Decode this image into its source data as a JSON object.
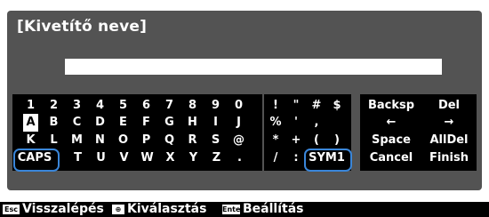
{
  "dialog": {
    "title": "[Kivetítő neve]",
    "input_value": ""
  },
  "keyboard": {
    "letters": [
      [
        "1",
        "2",
        "3",
        "4",
        "5",
        "6",
        "7",
        "8",
        "9",
        "0"
      ],
      [
        "A",
        "B",
        "C",
        "D",
        "E",
        "F",
        "G",
        "H",
        "I",
        "J"
      ],
      [
        "K",
        "L",
        "M",
        "N",
        "O",
        "P",
        "Q",
        "R",
        "S",
        "@"
      ],
      [
        "CAPS",
        "T",
        "U",
        "V",
        "W",
        "X",
        "Y",
        "Z",
        "."
      ]
    ],
    "symbols": [
      [
        "!",
        "\"",
        "#",
        "$"
      ],
      [
        "%",
        "'",
        ",",
        ""
      ],
      [
        "*",
        "+",
        "(",
        ")"
      ],
      [
        "/",
        ":",
        "SYM1"
      ]
    ],
    "functions": [
      [
        "Backsp",
        "Del"
      ],
      [
        "←",
        "→"
      ],
      [
        "Space",
        "AllDel"
      ],
      [
        "Cancel",
        "Finish"
      ]
    ],
    "selected_key": "A",
    "highlight_color": "#3a86d9"
  },
  "footer": {
    "back_badge": "Esc",
    "back_label": "Visszalépés",
    "select_badge": "⊕",
    "select_label": "Kiválasztás",
    "enter_badge": "Enter",
    "enter_label": "Beállítás"
  }
}
